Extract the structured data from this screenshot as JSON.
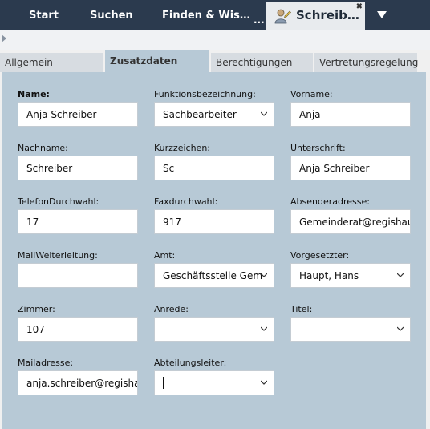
{
  "topbar": {
    "tabs": [
      "Start",
      "Suchen",
      "Finden & Wis…"
    ],
    "overflow": "...",
    "active_tab": {
      "label": "Schreib…",
      "icon": "user-edit-icon",
      "close": "✖"
    }
  },
  "inner_tabs": [
    "Allgemein",
    "Zusatzdaten",
    "Berechtigungen",
    "Vertretungsregelung"
  ],
  "form": {
    "name": {
      "label": "Name:",
      "value": "Anja Schreiber"
    },
    "funktion": {
      "label": "Funktionsbezeichnung:",
      "value": "Sachbearbeiter"
    },
    "vorname": {
      "label": "Vorname:",
      "value": "Anja"
    },
    "nachname": {
      "label": "Nachname:",
      "value": "Schreiber"
    },
    "kurzzeichen": {
      "label": "Kurzzeichen:",
      "value": "Sc"
    },
    "unterschrift": {
      "label": "Unterschrift:",
      "value": "Anja Schreiber"
    },
    "telefon": {
      "label": "TelefonDurchwahl:",
      "value": "17"
    },
    "fax": {
      "label": "Faxdurchwahl:",
      "value": "917"
    },
    "absender": {
      "label": "Absenderadresse:",
      "value": "Gemeinderat@regishaus"
    },
    "mailweiter": {
      "label": "MailWeiterleitung:",
      "value": ""
    },
    "amt": {
      "label": "Amt:",
      "value": "Geschäftsstelle Gem"
    },
    "vorgesetzter": {
      "label": "Vorgesetzter:",
      "value": "Haupt, Hans"
    },
    "zimmer": {
      "label": "Zimmer:",
      "value": "107"
    },
    "anrede": {
      "label": "Anrede:",
      "value": ""
    },
    "titel": {
      "label": "Titel:",
      "value": ""
    },
    "mailadresse": {
      "label": "Mailadresse:",
      "value": "anja.schreiber@regishaus"
    },
    "abteilungsleiter": {
      "label": "Abteilungsleiter:",
      "value": ""
    }
  },
  "colors": {
    "topbar": "#2b3a4e",
    "panel": "#b7c9d6",
    "inactive_tab": "#d7dce1"
  }
}
